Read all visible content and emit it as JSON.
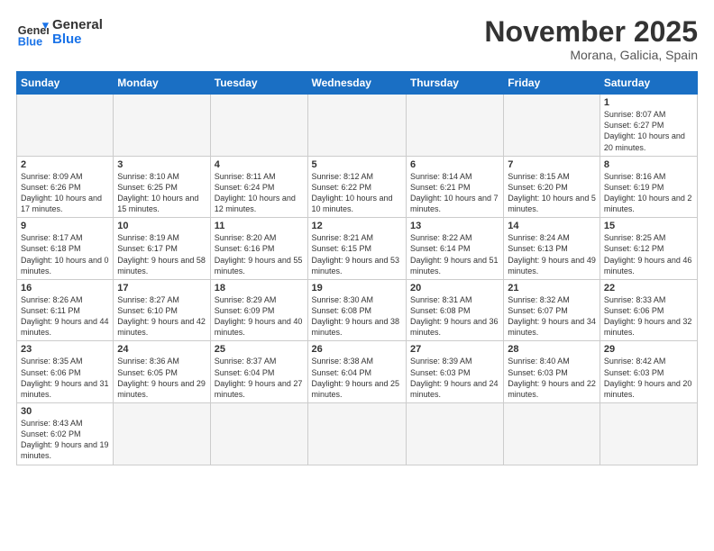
{
  "header": {
    "logo_general": "General",
    "logo_blue": "Blue",
    "month_title": "November 2025",
    "location": "Morana, Galicia, Spain"
  },
  "weekdays": [
    "Sunday",
    "Monday",
    "Tuesday",
    "Wednesday",
    "Thursday",
    "Friday",
    "Saturday"
  ],
  "weeks": [
    [
      {
        "day": "",
        "info": ""
      },
      {
        "day": "",
        "info": ""
      },
      {
        "day": "",
        "info": ""
      },
      {
        "day": "",
        "info": ""
      },
      {
        "day": "",
        "info": ""
      },
      {
        "day": "",
        "info": ""
      },
      {
        "day": "1",
        "info": "Sunrise: 8:07 AM\nSunset: 6:27 PM\nDaylight: 10 hours and 20 minutes."
      }
    ],
    [
      {
        "day": "2",
        "info": "Sunrise: 8:09 AM\nSunset: 6:26 PM\nDaylight: 10 hours and 17 minutes."
      },
      {
        "day": "3",
        "info": "Sunrise: 8:10 AM\nSunset: 6:25 PM\nDaylight: 10 hours and 15 minutes."
      },
      {
        "day": "4",
        "info": "Sunrise: 8:11 AM\nSunset: 6:24 PM\nDaylight: 10 hours and 12 minutes."
      },
      {
        "day": "5",
        "info": "Sunrise: 8:12 AM\nSunset: 6:22 PM\nDaylight: 10 hours and 10 minutes."
      },
      {
        "day": "6",
        "info": "Sunrise: 8:14 AM\nSunset: 6:21 PM\nDaylight: 10 hours and 7 minutes."
      },
      {
        "day": "7",
        "info": "Sunrise: 8:15 AM\nSunset: 6:20 PM\nDaylight: 10 hours and 5 minutes."
      },
      {
        "day": "8",
        "info": "Sunrise: 8:16 AM\nSunset: 6:19 PM\nDaylight: 10 hours and 2 minutes."
      }
    ],
    [
      {
        "day": "9",
        "info": "Sunrise: 8:17 AM\nSunset: 6:18 PM\nDaylight: 10 hours and 0 minutes."
      },
      {
        "day": "10",
        "info": "Sunrise: 8:19 AM\nSunset: 6:17 PM\nDaylight: 9 hours and 58 minutes."
      },
      {
        "day": "11",
        "info": "Sunrise: 8:20 AM\nSunset: 6:16 PM\nDaylight: 9 hours and 55 minutes."
      },
      {
        "day": "12",
        "info": "Sunrise: 8:21 AM\nSunset: 6:15 PM\nDaylight: 9 hours and 53 minutes."
      },
      {
        "day": "13",
        "info": "Sunrise: 8:22 AM\nSunset: 6:14 PM\nDaylight: 9 hours and 51 minutes."
      },
      {
        "day": "14",
        "info": "Sunrise: 8:24 AM\nSunset: 6:13 PM\nDaylight: 9 hours and 49 minutes."
      },
      {
        "day": "15",
        "info": "Sunrise: 8:25 AM\nSunset: 6:12 PM\nDaylight: 9 hours and 46 minutes."
      }
    ],
    [
      {
        "day": "16",
        "info": "Sunrise: 8:26 AM\nSunset: 6:11 PM\nDaylight: 9 hours and 44 minutes."
      },
      {
        "day": "17",
        "info": "Sunrise: 8:27 AM\nSunset: 6:10 PM\nDaylight: 9 hours and 42 minutes."
      },
      {
        "day": "18",
        "info": "Sunrise: 8:29 AM\nSunset: 6:09 PM\nDaylight: 9 hours and 40 minutes."
      },
      {
        "day": "19",
        "info": "Sunrise: 8:30 AM\nSunset: 6:08 PM\nDaylight: 9 hours and 38 minutes."
      },
      {
        "day": "20",
        "info": "Sunrise: 8:31 AM\nSunset: 6:08 PM\nDaylight: 9 hours and 36 minutes."
      },
      {
        "day": "21",
        "info": "Sunrise: 8:32 AM\nSunset: 6:07 PM\nDaylight: 9 hours and 34 minutes."
      },
      {
        "day": "22",
        "info": "Sunrise: 8:33 AM\nSunset: 6:06 PM\nDaylight: 9 hours and 32 minutes."
      }
    ],
    [
      {
        "day": "23",
        "info": "Sunrise: 8:35 AM\nSunset: 6:06 PM\nDaylight: 9 hours and 31 minutes."
      },
      {
        "day": "24",
        "info": "Sunrise: 8:36 AM\nSunset: 6:05 PM\nDaylight: 9 hours and 29 minutes."
      },
      {
        "day": "25",
        "info": "Sunrise: 8:37 AM\nSunset: 6:04 PM\nDaylight: 9 hours and 27 minutes."
      },
      {
        "day": "26",
        "info": "Sunrise: 8:38 AM\nSunset: 6:04 PM\nDaylight: 9 hours and 25 minutes."
      },
      {
        "day": "27",
        "info": "Sunrise: 8:39 AM\nSunset: 6:03 PM\nDaylight: 9 hours and 24 minutes."
      },
      {
        "day": "28",
        "info": "Sunrise: 8:40 AM\nSunset: 6:03 PM\nDaylight: 9 hours and 22 minutes."
      },
      {
        "day": "29",
        "info": "Sunrise: 8:42 AM\nSunset: 6:03 PM\nDaylight: 9 hours and 20 minutes."
      }
    ],
    [
      {
        "day": "30",
        "info": "Sunrise: 8:43 AM\nSunset: 6:02 PM\nDaylight: 9 hours and 19 minutes."
      },
      {
        "day": "",
        "info": ""
      },
      {
        "day": "",
        "info": ""
      },
      {
        "day": "",
        "info": ""
      },
      {
        "day": "",
        "info": ""
      },
      {
        "day": "",
        "info": ""
      },
      {
        "day": "",
        "info": ""
      }
    ]
  ]
}
